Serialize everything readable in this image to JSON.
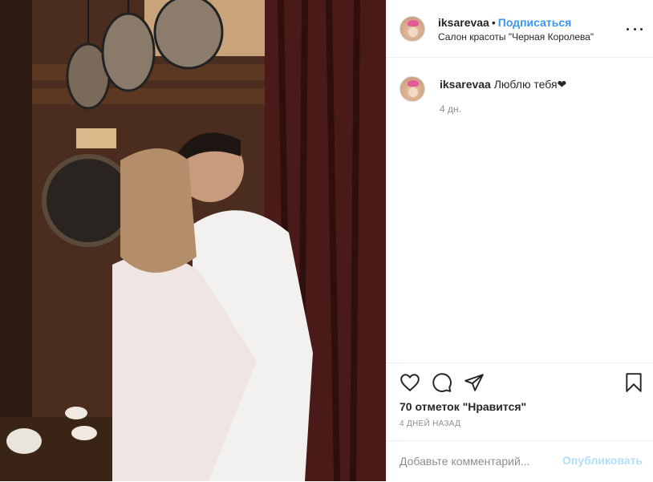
{
  "post": {
    "username": "iksarevaa",
    "separator": "•",
    "follow_label": "Подписаться",
    "location": "Салон красоты \"Черная Королева\""
  },
  "comment": {
    "username": "iksarevaa",
    "text": "Люблю тебя❤",
    "time": "4 дн."
  },
  "actions": {
    "like_icon": "heart-icon",
    "comment_icon": "comment-icon",
    "share_icon": "share-icon",
    "save_icon": "bookmark-icon"
  },
  "likes_text": "70 отметок \"Нравится\"",
  "posted_ago": "4 ДНЕЙ НАЗАД",
  "add_comment": {
    "placeholder": "Добавьте комментарий...",
    "publish_label": "Опубликовать"
  },
  "colors": {
    "accent": "#3897f0",
    "publish_disabled": "#b2dffc",
    "muted": "#8e8e8e"
  }
}
